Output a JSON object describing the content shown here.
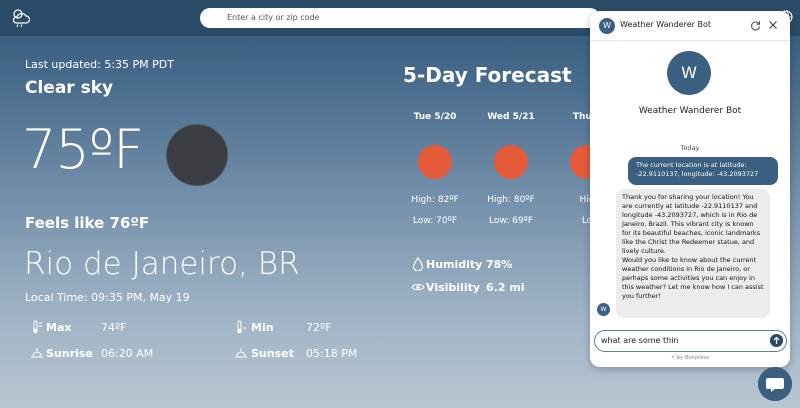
{
  "search": {
    "placeholder": "Enter a city or zip code"
  },
  "current": {
    "updated": "Last updated: 5:35 PM PDT",
    "condition": "Clear sky",
    "temp": "75ºF",
    "feels_like": "Feels like 76ºF",
    "city": "Rio de Janeiro, BR",
    "local_time": "Local Time: 09:35 PM, May 19",
    "stats": {
      "max_label": "Max",
      "max_value": "74ºF",
      "min_label": "Min",
      "min_value": "72ºF",
      "sunrise_label": "Sunrise",
      "sunrise_value": "06:20 AM",
      "sunset_label": "Sunset",
      "sunset_value": "05:18 PM"
    }
  },
  "forecast": {
    "title": "5-Day Forecast",
    "days": [
      {
        "day": "Tue 5/20",
        "high": "High: 82ºF",
        "low": "Low: 70ºF"
      },
      {
        "day": "Wed 5/21",
        "high": "High: 80ºF",
        "low": "Low: 69ºF"
      },
      {
        "day": "Thu 5",
        "high": "Hig",
        "low": "Lo"
      }
    ],
    "humidity_label": "Humidity",
    "humidity_value": "78%",
    "visibility_label": "Visibility",
    "visibility_value": "6.2 mi"
  },
  "chat": {
    "bot_name": "Weather Wanderer Bot",
    "avatar_letter": "W",
    "date_divider": "Today",
    "user_msg": "The current location is at latitude: -22.9110137, longitude: -43.2093727",
    "bot_msg_1": "Thank you for sharing your location! You are currently at latitude -22.9110137 and longitude -43.2093727, which is in Rio de Janeiro, Brazil. This vibrant city is known for its beautiful beaches, iconic landmarks like the Christ the Redeemer statue, and lively culture.",
    "bot_msg_2": "Would you like to know about the current weather conditions in Rio de Janeiro, or perhaps some activities you can enjoy in this weather? Let me know how I can assist you further!",
    "input_value": "what are some thin",
    "powered_by": "⚡ by Botpress"
  },
  "colors": {
    "accent": "#3b5f80",
    "topbar": "#2a4c68",
    "forecast_dot": "#e55b3a"
  }
}
